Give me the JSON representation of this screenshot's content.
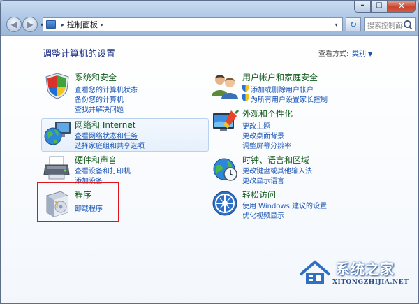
{
  "window": {
    "buttons": {
      "minimize": "–",
      "maximize": "□",
      "close": "✕"
    }
  },
  "nav": {
    "back_glyph": "◀",
    "forward_glyph": "▶",
    "dropdown_glyph": "▾"
  },
  "address": {
    "separator": "▸",
    "path": "控制面板",
    "after": "▸",
    "dropdown": "▾"
  },
  "refresh_glyph": "↻",
  "search": {
    "placeholder": "搜索控制面板"
  },
  "header": {
    "title": "调整计算机的设置",
    "view_by_label": "查看方式:",
    "view_by_value": "类别",
    "view_caret": "▼"
  },
  "categories": {
    "system": {
      "title": "系统和安全",
      "links": [
        "查看您的计算机状态",
        "备份您的计算机",
        "查找并解决问题"
      ]
    },
    "network": {
      "title": "网络和 Internet",
      "links": [
        "查看网络状态和任务",
        "选择家庭组和共享选项"
      ]
    },
    "hardware": {
      "title": "硬件和声音",
      "links": [
        "查看设备和打印机",
        "添加设备"
      ]
    },
    "programs": {
      "title": "程序",
      "links": [
        "卸载程序"
      ]
    },
    "users": {
      "title": "用户帐户和家庭安全",
      "links": [
        "添加或删除用户帐户",
        "为所有用户设置家长控制"
      ]
    },
    "appearance": {
      "title": "外观和个性化",
      "links": [
        "更改主题",
        "更改桌面背景",
        "调整屏幕分辨率"
      ]
    },
    "clock": {
      "title": "时钟、语言和区域",
      "links": [
        "更改键盘或其他输入法",
        "更改显示语言"
      ]
    },
    "ease": {
      "title": "轻松访问",
      "links": [
        "使用 Windows 建议的设置",
        "优化视频显示"
      ]
    }
  },
  "watermark": {
    "name": "系统之家",
    "url": "XITONGZHIJIA.NET"
  }
}
